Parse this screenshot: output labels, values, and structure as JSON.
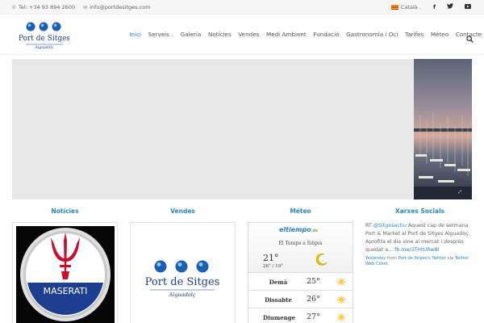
{
  "topbar": {
    "phone": "Tel: +34 93 894 2600",
    "email": "info@portdesitges.com",
    "language": "Català"
  },
  "nav": {
    "items": [
      {
        "label": "Inici",
        "active": true
      },
      {
        "label": "Serveis",
        "dropdown": true
      },
      {
        "label": "Galeria"
      },
      {
        "label": "Notícies"
      },
      {
        "label": "Vendes"
      },
      {
        "label": "Medi Ambient"
      },
      {
        "label": "Fundació"
      },
      {
        "label": "Gastronomia i Oci"
      },
      {
        "label": "Tarifes"
      },
      {
        "label": "Méteo"
      },
      {
        "label": "Contacte"
      }
    ]
  },
  "logo": {
    "text": "Port de Sitges",
    "subtext": "Aiguadolç"
  },
  "sections": {
    "noticies": "Notícies",
    "vendes": "Vendes",
    "meteo": "Méteo",
    "xarxes": "Xarxes Socials"
  },
  "news_image": {
    "brand": "MASERATI"
  },
  "weather": {
    "provider": "eltiempo",
    "provider_tld": ".es",
    "title": "El Temps a Sitges",
    "current_temp": "21°",
    "range": "26° / 19°",
    "forecast": [
      {
        "day": "Demà",
        "temp": "25°"
      },
      {
        "day": "Dissabte",
        "temp": "26°"
      },
      {
        "day": "Diumenge",
        "temp": "27°"
      }
    ]
  },
  "twitter": {
    "prefix": "RT ",
    "handle": "@Sitgesactiu",
    "text": " Aquest cap de setmana Port & Market al Port de Sitges Aiguadoç. Aprofita el dia vine al mercat i després quedat a...",
    "link": "fb.me/3THtURw8l",
    "meta_when": "Yesterday",
    "meta_from": " from ",
    "meta_source": "Port de Sitges's Twitter",
    "meta_via": " via ",
    "meta_client": "Twitter Web Client"
  },
  "colors": {
    "accent": "#2e86c1",
    "nav_active": "#1c8ad1",
    "slider_bg": "#e7e7e7"
  }
}
